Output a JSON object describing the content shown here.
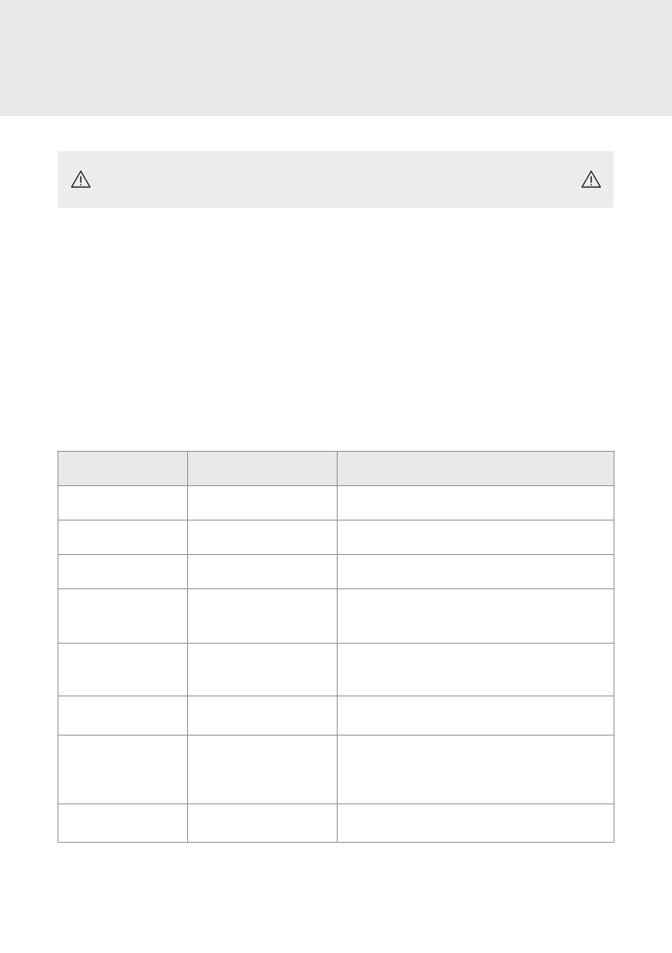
{
  "header": {
    "title": ""
  },
  "warning": {
    "icon_left": "warning-triangle-icon",
    "icon_right": "warning-triangle-icon",
    "text": ""
  },
  "table": {
    "headers": [
      "",
      "",
      ""
    ],
    "rows": [
      [
        "",
        "",
        ""
      ],
      [
        "",
        "",
        ""
      ],
      [
        "",
        "",
        ""
      ],
      [
        "",
        "",
        ""
      ],
      [
        "",
        "",
        ""
      ],
      [
        "",
        "",
        ""
      ],
      [
        "",
        "",
        ""
      ],
      [
        "",
        "",
        ""
      ]
    ]
  },
  "colors": {
    "header_band": "#e8e8e8",
    "warning_background": "#ececec",
    "table_header_background": "#e8e8e8",
    "table_border": "#8c8c8c"
  }
}
